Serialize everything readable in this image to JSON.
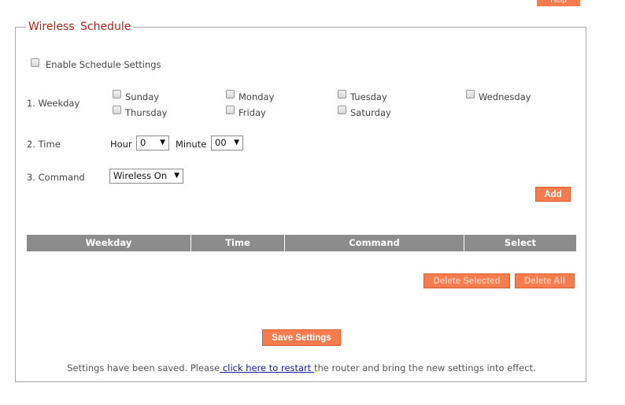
{
  "help": {
    "label": "Help"
  },
  "panel": {
    "title": "Wireless Schedule"
  },
  "enable": {
    "label": "Enable Schedule Settings"
  },
  "weekday": {
    "label": "1. Weekday",
    "days": [
      "Sunday",
      "Monday",
      "Tuesday",
      "Wednesday",
      "Thursday",
      "Friday",
      "Saturday"
    ]
  },
  "time": {
    "label": "2. Time",
    "hour_label": "Hour",
    "hour_value": "0",
    "minute_label": "Minute",
    "minute_value": "00"
  },
  "command": {
    "label": "3. Command",
    "value": "Wireless On"
  },
  "add_button": "Add",
  "table": {
    "headers": [
      "Weekday",
      "Time",
      "Command",
      "Select"
    ]
  },
  "delete_selected": "Delete Selected",
  "delete_all": "Delete All",
  "save_button": "Save Settings",
  "footer": {
    "before": "Settings have been saved. Please",
    "link": " click here to restart ",
    "after": "the router and bring the new settings into effect."
  },
  "colors": {
    "accent": "#f47c4e",
    "title": "#b3231a",
    "table_header": "#8c8c8c"
  }
}
